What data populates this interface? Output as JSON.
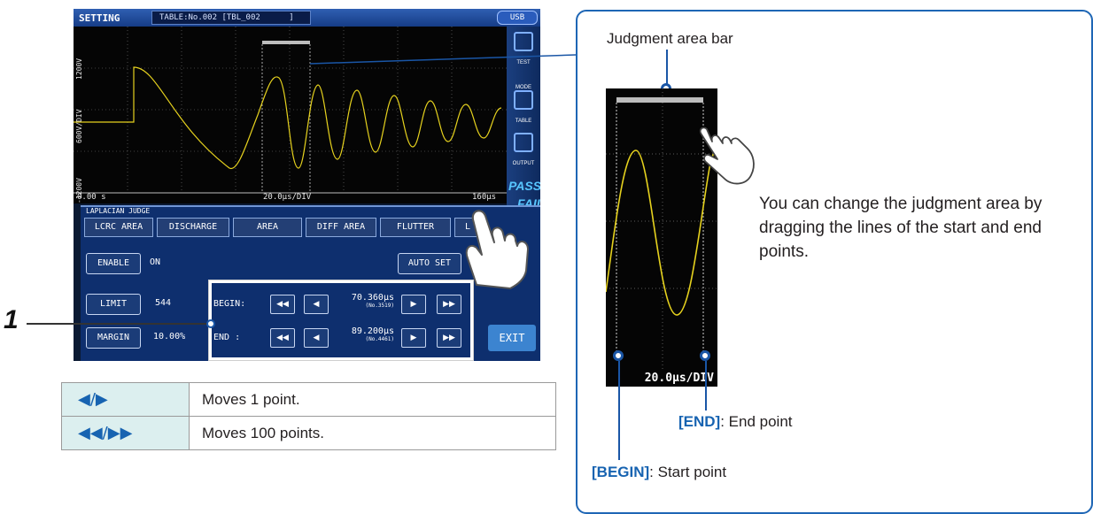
{
  "device": {
    "mode": "SETTING",
    "table_tag": "TABLE:No.002 [TBL_002      ]",
    "usb": "USB",
    "y_top": "1200V",
    "y_div": "600V/DIV",
    "y_bottom": "-1200V",
    "x_start": "0.00 s",
    "x_div": "20.0μs/DIV",
    "x_end": "160μs",
    "side_menu": [
      "TEST",
      "MODE",
      "TABLE",
      "OUTPUT"
    ],
    "pass_label": "PASS",
    "fail_label": "FAIL"
  },
  "panel": {
    "title": "LAPLACIAN JUDGE",
    "tabs": [
      "LCRC AREA",
      "DISCHARGE",
      "AREA",
      "DIFF AREA",
      "FLUTTER",
      "L"
    ],
    "enable_label": "ENABLE",
    "enable_value": "ON",
    "auto_set_label": "AUTO SET",
    "limit_label": "LIMIT",
    "limit_value": "544",
    "margin_label": "MARGIN",
    "margin_value": "10.00%",
    "begin_label": "BEGIN:",
    "begin_time": "70.360μs",
    "begin_no": "(No.3519)",
    "end_label": "END  :",
    "end_time": "89.200μs",
    "end_no": "(No.4461)",
    "nav_fast_back": "◀◀",
    "nav_back": "◀",
    "nav_fwd": "▶",
    "nav_fast_fwd": "▶▶",
    "exit_label": "EXIT"
  },
  "callouts": {
    "step_number": "1",
    "legend": [
      {
        "symbol": "◀/▶",
        "text": "Moves 1 point."
      },
      {
        "symbol": "◀◀/▶▶",
        "text": "Moves 100 points."
      }
    ]
  },
  "zoom": {
    "title": "Judgment area bar",
    "axis_label": "20.0μs/DIV",
    "description": "You can change the judgment area by dragging the lines of the start and end points.",
    "end_kw": "[END]",
    "end_text": ": End point",
    "begin_kw": "[BEGIN]",
    "begin_text": ": Start point"
  },
  "colors": {
    "waveform": "#e6d21e",
    "accent": "#1763b1",
    "screen_bg": "#0b1a33"
  }
}
